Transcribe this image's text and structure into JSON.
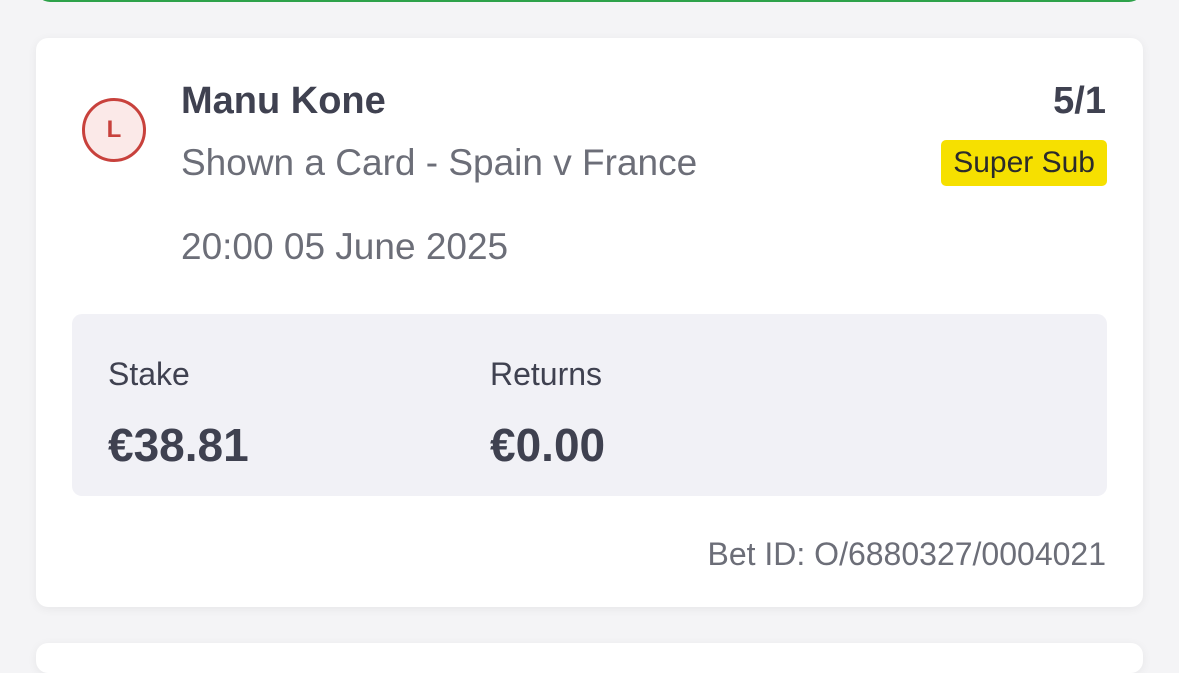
{
  "bet": {
    "result_badge": "L",
    "selection": "Manu Kone",
    "market": "Shown a Card - Spain v France",
    "datetime": "20:00 05 June 2025",
    "odds": "5/1",
    "promo_badge": "Super Sub",
    "stake_label": "Stake",
    "stake_value": "€38.81",
    "returns_label": "Returns",
    "returns_value": "€0.00",
    "bet_id": "Bet ID: O/6880327/0004021"
  },
  "colors": {
    "loss": "#c8413c",
    "promo": "#f6e000",
    "win_border": "#2ea24a",
    "panel": "#f1f1f6"
  }
}
